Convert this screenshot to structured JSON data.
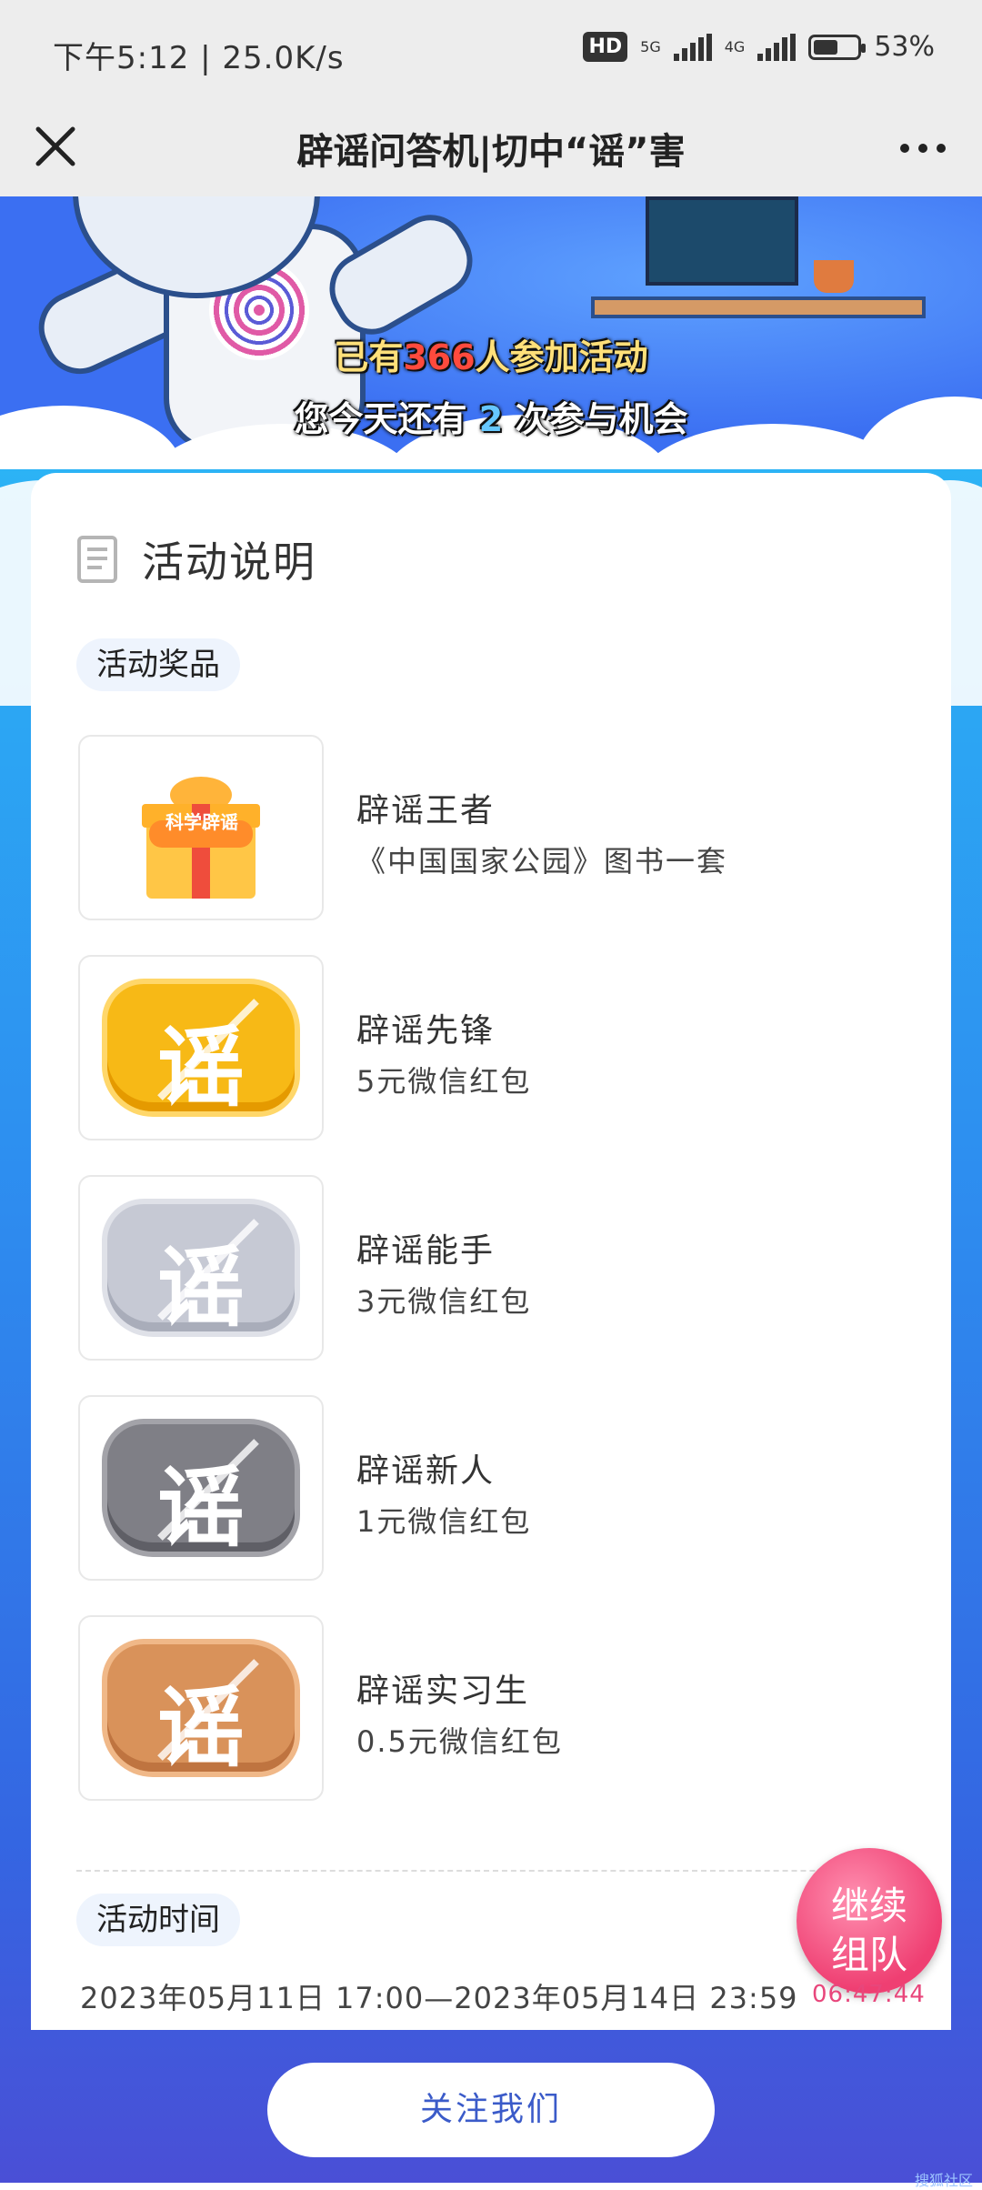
{
  "status_bar": {
    "left": "下午5:12 | 25.0K/s",
    "hd": "HD",
    "net1": "5G",
    "net2": "4G",
    "battery": "53%"
  },
  "title_bar": {
    "title": "辟谣问答机|切中“谣”害"
  },
  "banner": {
    "line1_prefix": "已有",
    "line1_count": "366",
    "line1_suffix": "人参加活动",
    "line2_prefix": "您今天还有",
    "line2_count": "2",
    "line2_suffix": "次参与机会"
  },
  "section": {
    "title": "活动说明",
    "prizes_label": "活动奖品",
    "time_label": "活动时间",
    "time_value": "2023年05月11日 17:00—2023年05月14日 23:59"
  },
  "prizes": [
    {
      "name": "辟谣王者",
      "desc": "《中国国家公园》图书一套",
      "gift_text": "科学辟谣"
    },
    {
      "name": "辟谣先锋",
      "desc": "5元微信红包",
      "badge_char": "谣",
      "color": "#f7b916"
    },
    {
      "name": "辟谣能手",
      "desc": "3元微信红包",
      "badge_char": "谣",
      "color": "#c6c9d4"
    },
    {
      "name": "辟谣新人",
      "desc": "1元微信红包",
      "badge_char": "谣",
      "color": "#7f7f86"
    },
    {
      "name": "辟谣实习生",
      "desc": "0.5元微信红包",
      "badge_char": "谣",
      "color": "#d9925a"
    }
  ],
  "fab": {
    "line1": "继续",
    "line2": "组队",
    "countdown": "06:47:44"
  },
  "footer": {
    "follow": "关注我们",
    "corner": "搜狐社区"
  }
}
